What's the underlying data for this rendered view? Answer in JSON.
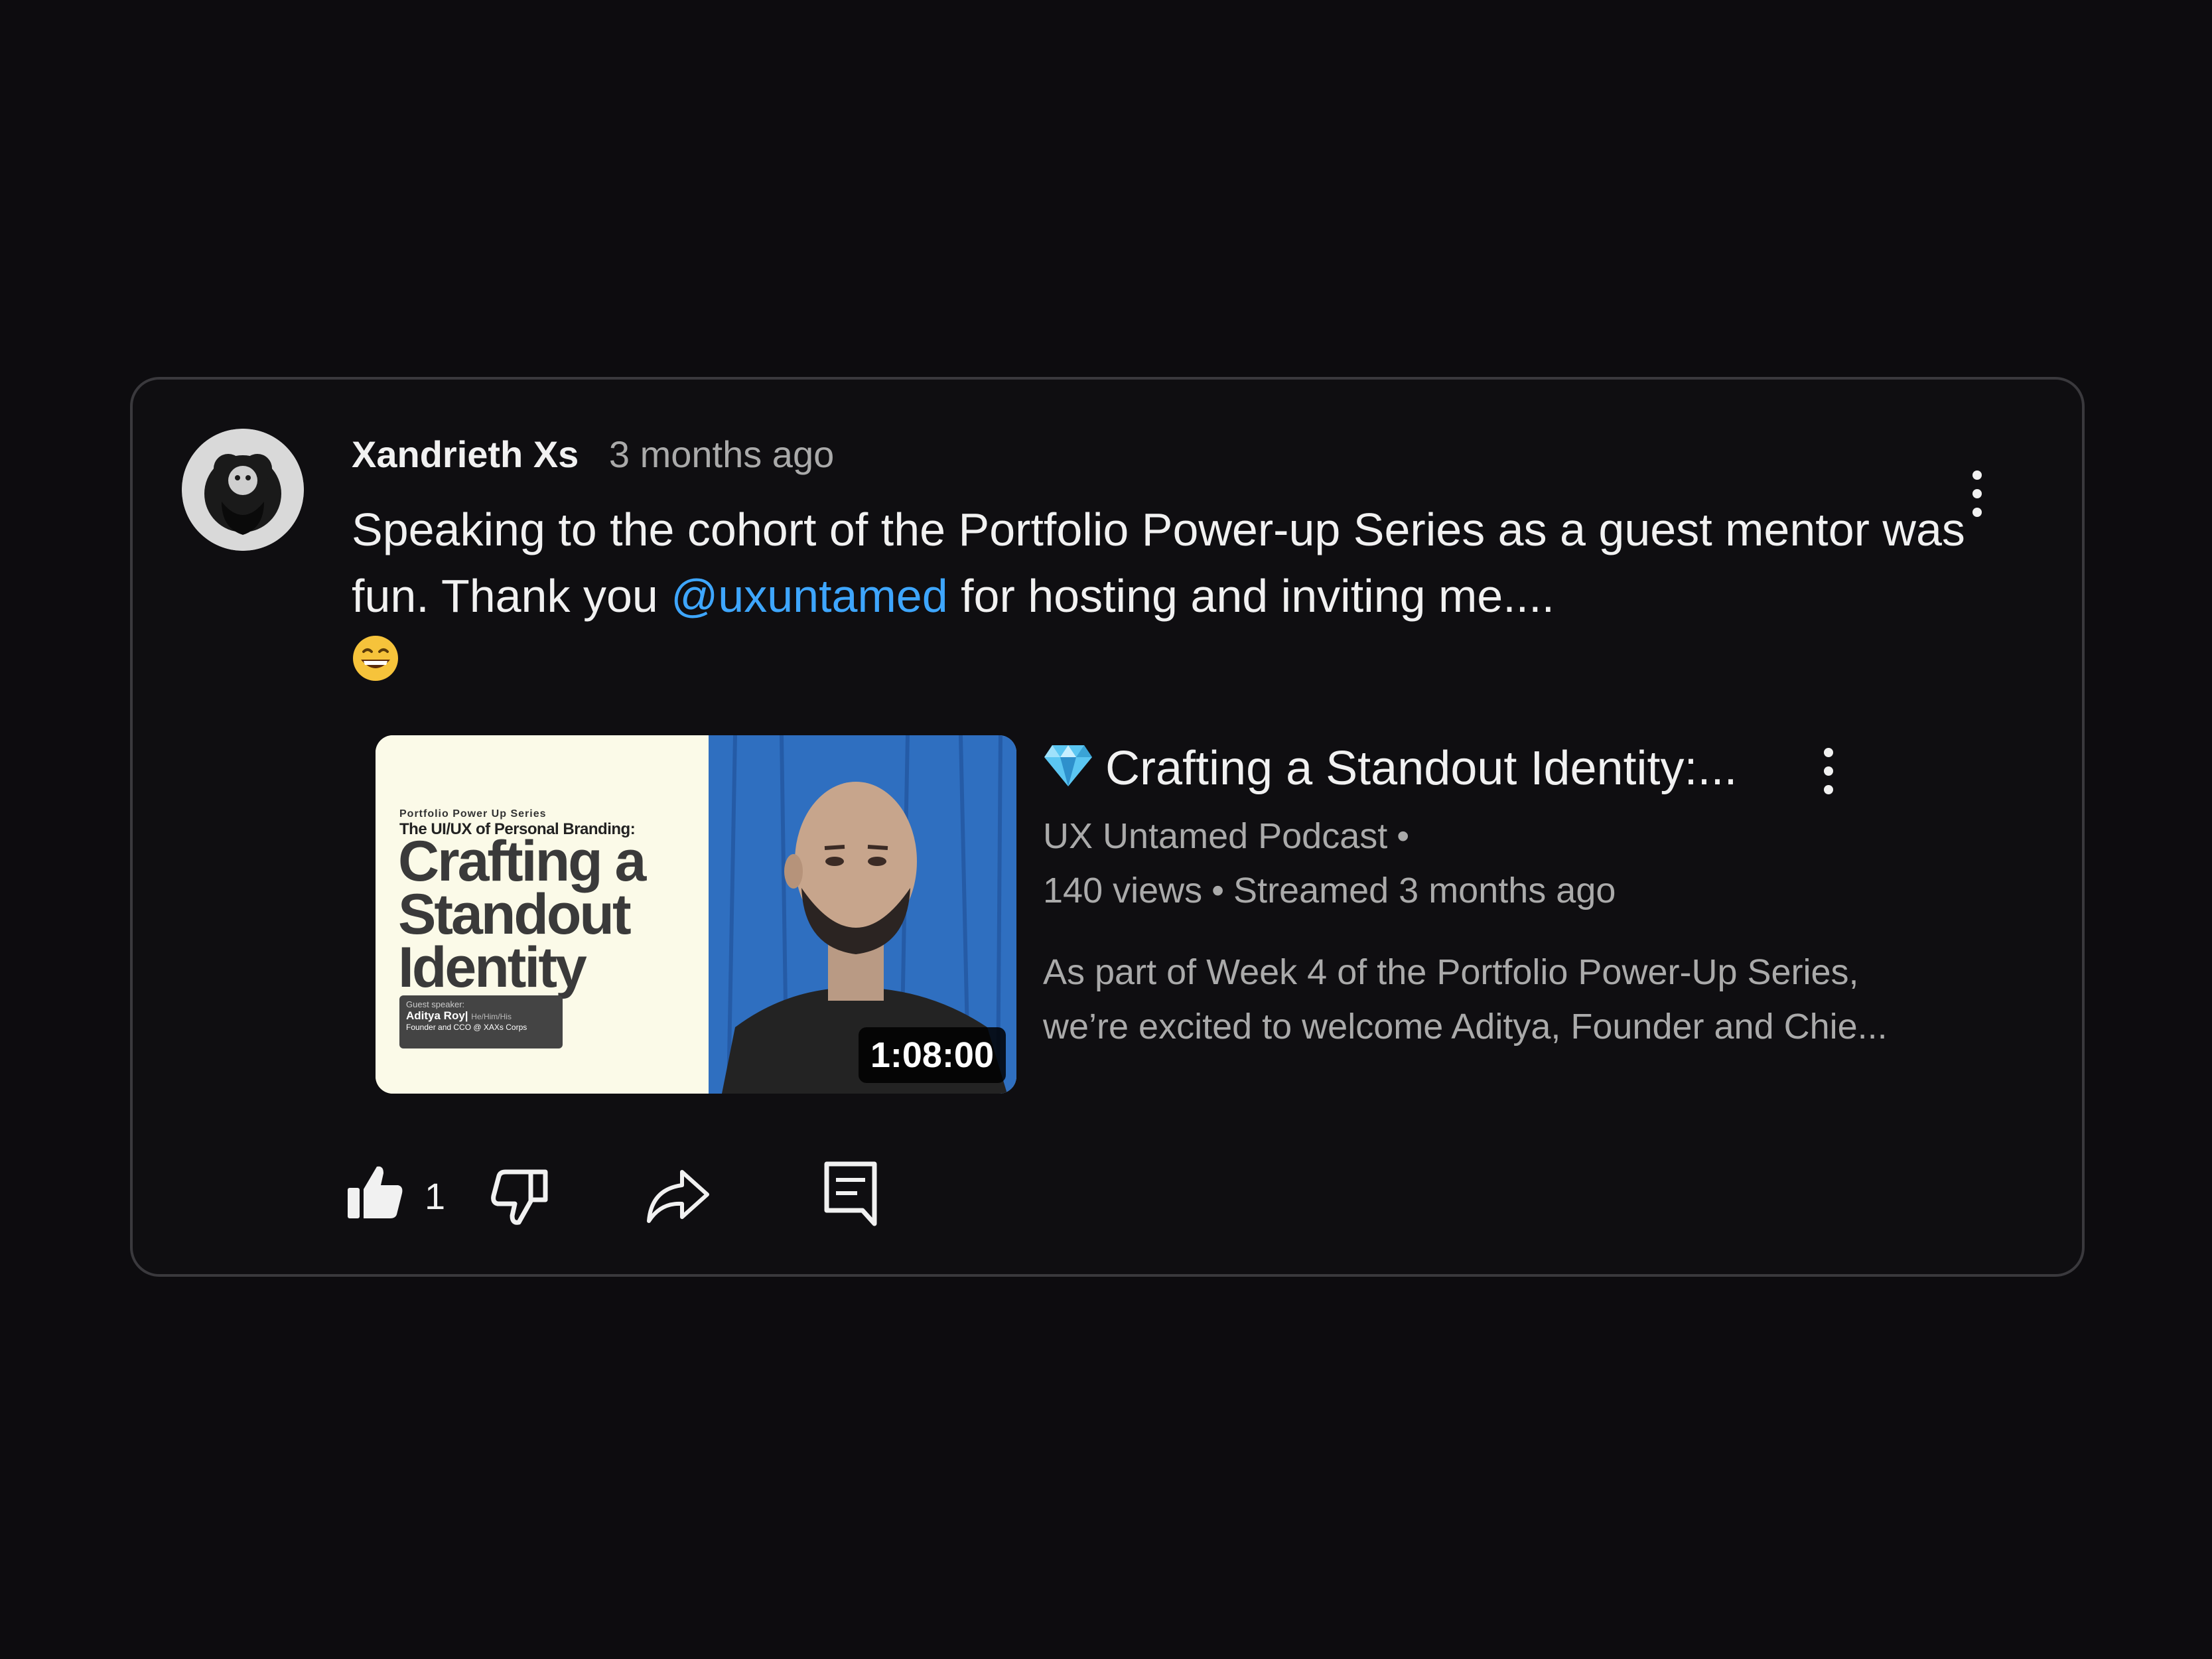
{
  "comment": {
    "author": "Xandrieth Xs",
    "time": "3 months ago",
    "text_before": "Speaking to the cohort of the Portfolio Power-up Series as a guest mentor was fun. Thank you ",
    "mention": "@uxuntamed",
    "text_after": " for hosting and inviting me....",
    "emoji": "grinning-face",
    "like_count": "1"
  },
  "video": {
    "title": "Crafting a Standout Identity:...",
    "title_icon": "gem-icon",
    "channel": "UX Untamed Podcast",
    "channel_sep": "•",
    "views": "140 views",
    "stats_sep": "•",
    "streamed": "Streamed 3 months ago",
    "description_line1": "As part of Week 4 of the Portfolio Power-Up Series,",
    "description_line2": "we’re excited to welcome Aditya, Founder and Chie...",
    "duration": "1:08:00",
    "thumbnail": {
      "series": "Portfolio Power Up Series",
      "subtitle": "The UI/UX of Personal Branding:",
      "big_line1": "Crafting a",
      "big_line2": "Standout",
      "big_line3": "Identity",
      "speaker_label": "Guest speaker:",
      "speaker_name": "Aditya Roy|",
      "speaker_pronouns": "He/Him/His",
      "speaker_role": "Founder and CCO @ XAXs Corps"
    }
  },
  "colors": {
    "background": "#0d0c0f",
    "card_border": "#3a393d",
    "mention": "#3ea6ff",
    "secondary_text": "#aaaaaa",
    "thumb_blue": "#2f6fc0"
  }
}
